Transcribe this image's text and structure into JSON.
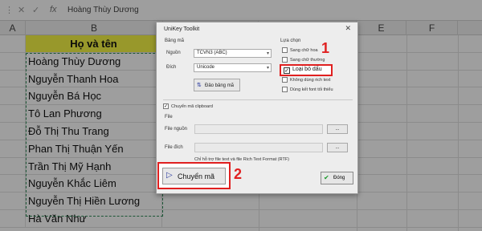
{
  "formula_bar": {
    "cancel_glyph": "✕",
    "confirm_glyph": "✓",
    "fx_label": "fx",
    "content": "Hoàng Thùy Dương"
  },
  "columns": [
    "A",
    "B",
    "C",
    "D",
    "E",
    "F"
  ],
  "sheet": {
    "header": "Họ và tên",
    "names": [
      "Hoàng Thùy Dương",
      "Nguyễn Thanh Hoa",
      "Nguyễn Bá Học",
      "Tô Lan Phương",
      "Đỗ Thị Thu Trang",
      "Phan Thị Thuận Yến",
      "Trần Thị Mỹ Hạnh",
      "Nguyễn Khắc Liêm",
      "Nguyễn Thị Hiền Lương",
      "Hà Văn Như"
    ]
  },
  "dialog": {
    "title": "UniKey Toolkit",
    "close_glyph": "✕",
    "charset_group": "Bảng mã",
    "source_label": "Nguồn",
    "source_value": "TCVN3 (ABC)",
    "dest_label": "Đích",
    "dest_value": "Unicode",
    "swap_button": "Đảo bảng mã",
    "options_group": "Lựa chọn",
    "options": [
      {
        "label": "Sang chữ hoa",
        "checked": false
      },
      {
        "label": "Sang chữ thường",
        "checked": false
      },
      {
        "label": "Loại bỏ dấu",
        "checked": true
      },
      {
        "label": "Không dùng rich text",
        "checked": false
      },
      {
        "label": "Dùng kết font tối thiểu",
        "checked": false
      }
    ],
    "clipboard_label": "Chuyển mã clipboard",
    "clipboard_checked": true,
    "file_group": "File",
    "file_source_label": "File nguồn",
    "file_dest_label": "File đích",
    "browse_label": "...",
    "note": "Chỉ hỗ trợ file text và file Rich Text Format (RTF)",
    "convert_button": "Chuyển mã",
    "close_button": "Đóng"
  },
  "annotations": {
    "step1": "1",
    "step2": "2"
  },
  "colors": {
    "header_fill": "#f5f546",
    "highlight": "#e02020"
  }
}
